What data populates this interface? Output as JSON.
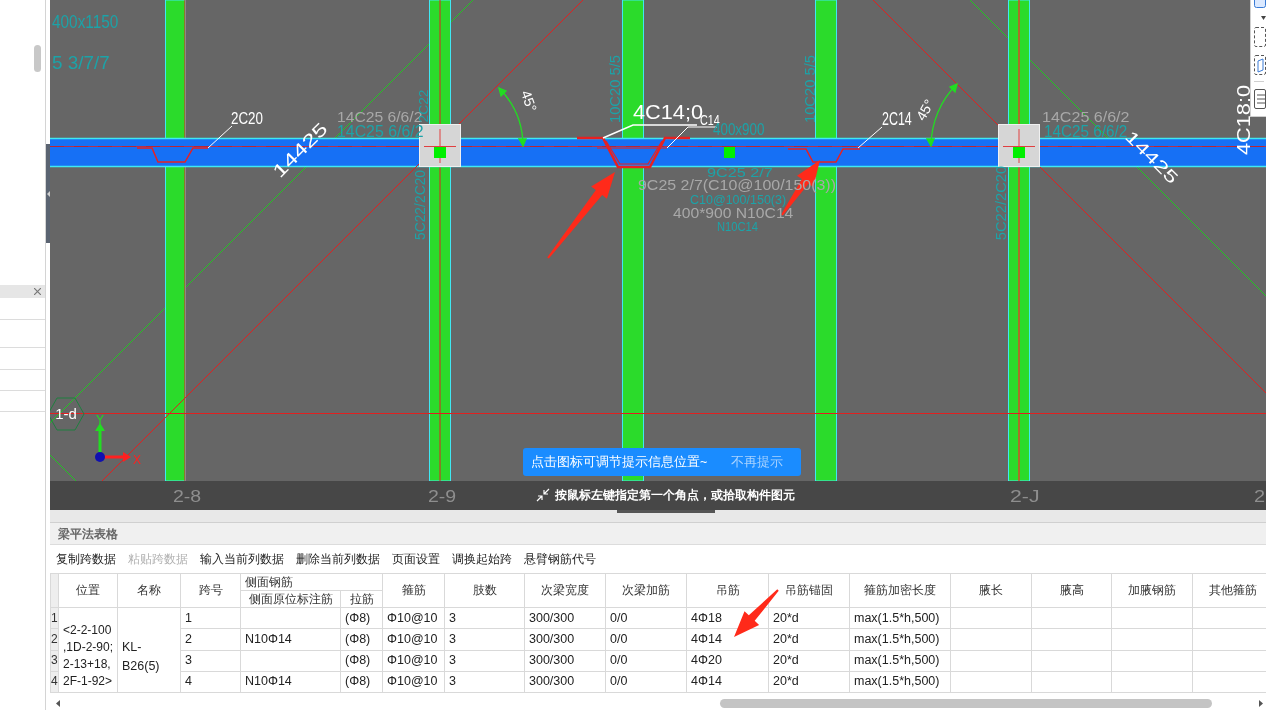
{
  "canvas": {
    "labels": [
      {
        "text": "400x1150",
        "kind": "plan"
      },
      {
        "text": "5 3/7/7",
        "kind": "plan"
      },
      {
        "text": "2C20",
        "kind": "bar"
      },
      {
        "text": "14C25 6/6/2",
        "kind": "span"
      },
      {
        "text": "14C25 6/6/2",
        "kind": "plan"
      },
      {
        "text": "14425",
        "kind": "bar"
      },
      {
        "text": "45°",
        "kind": "bar"
      },
      {
        "text": "4C14;0",
        "kind": "bar"
      },
      {
        "text": "C14",
        "kind": "bar"
      },
      {
        "text": "400x900",
        "kind": "plan"
      },
      {
        "text": "2C14",
        "kind": "bar"
      },
      {
        "text": "45°",
        "kind": "bar"
      },
      {
        "text": "14C25 6/6/2",
        "kind": "span"
      },
      {
        "text": "14C25 6/6/2",
        "kind": "plan"
      },
      {
        "text": "14425",
        "kind": "bar"
      },
      {
        "text": "4C18:0",
        "kind": "bar"
      },
      {
        "text": "9C25 2/7",
        "kind": "plan"
      },
      {
        "text": "9C25 2/7(C10@100/150(3))",
        "kind": "span"
      },
      {
        "text": "C10@100/150(3)",
        "kind": "plan"
      },
      {
        "text": "400*900 N10C14",
        "kind": "span"
      },
      {
        "text": "N10C14",
        "kind": "plan"
      },
      {
        "text": "10C20 5/5",
        "kind": "plan"
      },
      {
        "text": "10C20 5/5",
        "kind": "plan"
      },
      {
        "text": "2C22",
        "kind": "plan"
      },
      {
        "text": "5C22/2C20",
        "kind": "plan"
      },
      {
        "text": "5C22/2C20",
        "kind": "plan"
      },
      {
        "text": "1-d",
        "kind": "axis"
      },
      {
        "text": "2-8",
        "kind": "grid"
      },
      {
        "text": "2-9",
        "kind": "grid"
      },
      {
        "text": "2-J",
        "kind": "grid"
      },
      {
        "text": "2",
        "kind": "grid"
      }
    ],
    "ucs": {
      "x": "X",
      "y": "Y"
    },
    "tip": {
      "text": "点击图标可调节提示信息位置~",
      "dismiss": "不再提示"
    },
    "prompt": "按鼠标左键指定第一个角点，或拾取构件图元"
  },
  "table": {
    "title": "梁平法表格",
    "toolbar": [
      {
        "label": "复制跨数据",
        "disabled": false
      },
      {
        "label": "粘贴跨数据",
        "disabled": true
      },
      {
        "label": "输入当前列数据",
        "disabled": false
      },
      {
        "label": "删除当前列数据",
        "disabled": false
      },
      {
        "label": "页面设置",
        "disabled": false
      },
      {
        "label": "调换起始跨",
        "disabled": false
      },
      {
        "label": "悬臂钢筋代号",
        "disabled": false
      }
    ],
    "columns": [
      {
        "label": "位置"
      },
      {
        "label": "名称"
      },
      {
        "label": "跨号"
      },
      {
        "label": "侧面钢筋",
        "children": [
          {
            "label": "侧面原位标注筋"
          },
          {
            "label": "拉筋"
          }
        ]
      },
      {
        "label": "箍筋"
      },
      {
        "label": "肢数"
      },
      {
        "label": "次梁宽度"
      },
      {
        "label": "次梁加筋"
      },
      {
        "label": "吊筋"
      },
      {
        "label": "吊筋锚固"
      },
      {
        "label": "箍筋加密长度"
      },
      {
        "label": "腋长"
      },
      {
        "label": "腋高"
      },
      {
        "label": "加腋钢筋"
      },
      {
        "label": "其他箍筋"
      }
    ],
    "group": {
      "position": "<2-2-100,1D-2-90;2-13+18,2F-1-92>",
      "name": "KL-B26(5)"
    },
    "rows": [
      {
        "number": "1",
        "span": "1",
        "tie": "(Φ8)",
        "stirrup": "Φ10@10",
        "legs": "3",
        "secondary_width": "300/300",
        "secondary_bars": "0/0",
        "hanger": "4Φ18",
        "hanger_anchor": "20*d",
        "dense_length": "max(1.5*h,500)"
      },
      {
        "number": "2",
        "span": "2",
        "side_bar": "N10Φ14",
        "tie": "(Φ8)",
        "stirrup": "Φ10@10",
        "legs": "3",
        "secondary_width": "300/300",
        "secondary_bars": "0/0",
        "hanger": "4Φ14",
        "hanger_anchor": "20*d",
        "dense_length": "max(1.5*h,500)"
      },
      {
        "number": "3",
        "span": "3",
        "tie": "(Φ8)",
        "stirrup": "Φ10@10",
        "legs": "3",
        "secondary_width": "300/300",
        "secondary_bars": "0/0",
        "hanger": "4Φ20",
        "hanger_anchor": "20*d",
        "dense_length": "max(1.5*h,500)"
      },
      {
        "number": "4",
        "span": "4",
        "side_bar": "N10Φ14",
        "tie": "(Φ8)",
        "stirrup": "Φ10@10",
        "legs": "3",
        "secondary_width": "300/300",
        "secondary_bars": "0/0",
        "hanger": "4Φ14",
        "hanger_anchor": "20*d",
        "dense_length": "max(1.5*h,500)"
      }
    ]
  }
}
